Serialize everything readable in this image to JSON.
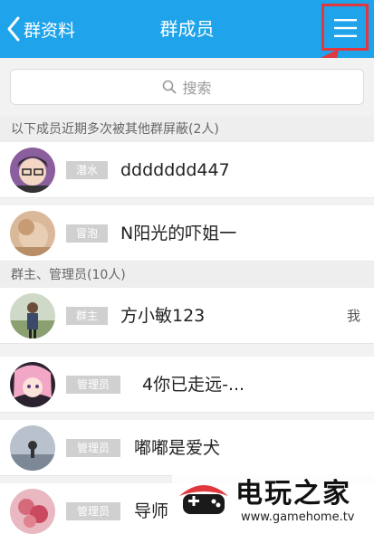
{
  "header": {
    "back_label": "群资料",
    "title": "群成员"
  },
  "search": {
    "placeholder": "搜索"
  },
  "sections": [
    {
      "title": "以下成员近期多次被其他群屏蔽(2人)",
      "members": [
        {
          "badge": "潜水",
          "name": "ddddddd447"
        },
        {
          "badge": "冒泡",
          "name": "N阳光的吓姐一"
        }
      ]
    },
    {
      "title": "群主、管理员(10人)",
      "members": [
        {
          "badge": "群主",
          "name": "方小敏123",
          "self_tag": "我"
        },
        {
          "badge": "管理员",
          "name": "4你已走远-..."
        },
        {
          "badge": "管理员",
          "name": "嘟嘟是爱犬"
        },
        {
          "badge": "管理员",
          "name": "导师"
        }
      ]
    }
  ],
  "watermark": {
    "brand": "电玩之家",
    "url": "www.gamehome.tv"
  },
  "colors": {
    "header_bg": "#1fa3ea",
    "highlight": "#e0383e",
    "badge_bg": "#d0d0d0"
  }
}
